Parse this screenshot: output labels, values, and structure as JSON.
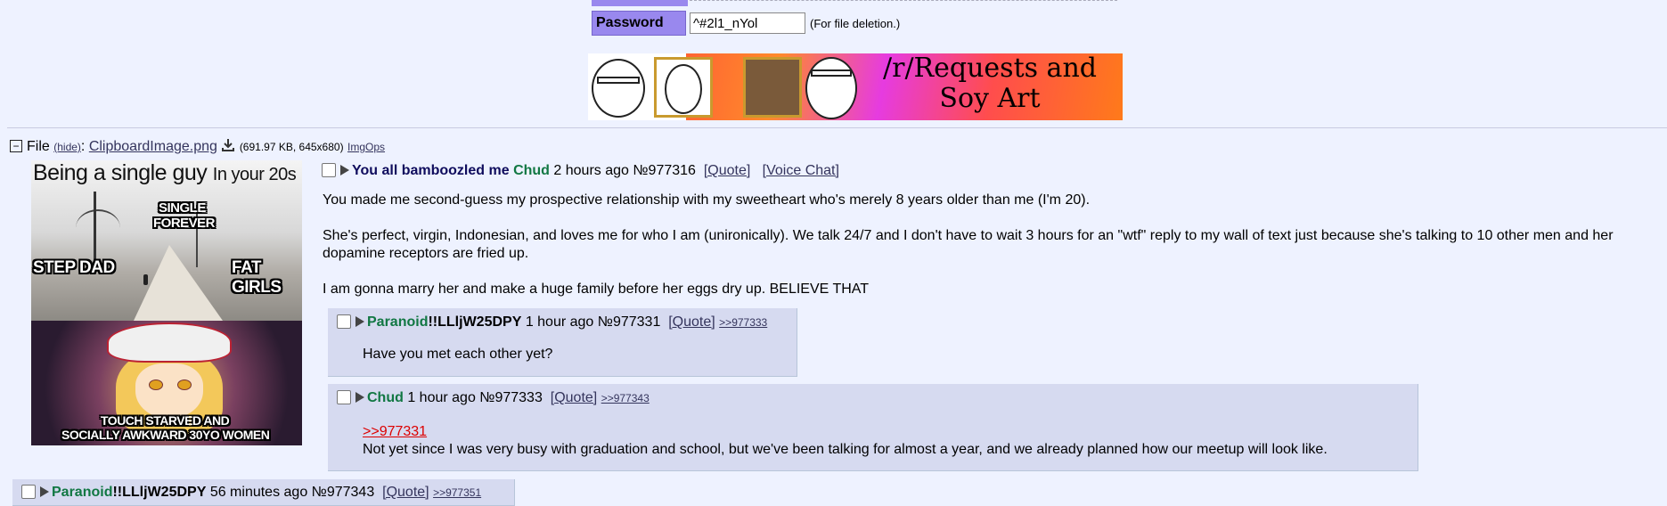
{
  "form": {
    "password_label": "Password",
    "password_value": "^#2l1_nYol",
    "password_note": "(For file deletion.)"
  },
  "banner": {
    "line1": "/r/Requests and",
    "line2": "Soy Art"
  },
  "file": {
    "toggle": "−",
    "label": "File",
    "hide": "(hide)",
    "filename": "ClipboardImage.png",
    "meta": "(691.97 KB, 645x680)",
    "imgops": "ImgOps"
  },
  "thumbnail": {
    "caption_title": "Being a single guy",
    "caption_title_small": "In your 20s",
    "caption_single": "SINGLE",
    "caption_forever": "FOREVER",
    "caption_stepdad": "STEP DAD",
    "caption_fatgirls": "FAT GIRLS",
    "caption_touch1": "TOUCH STARVED AND",
    "caption_touch2": "SOCIALLY AWKWARD 30YO WOMEN"
  },
  "op": {
    "subject": "You all bamboozled me",
    "name": "Chud",
    "time": "2 hours ago",
    "number": "№977316",
    "quote": "[Quote]",
    "voice_chat": "[Voice Chat]",
    "paragraphs": [
      "You made me second-guess my prospective relationship with my sweetheart who's merely 8 years older than me (I'm 20).",
      "She's perfect, virgin, Indonesian, and loves me for who I am (unironically). We talk 24/7 and I don't have to wait 3 hours for an \"wtf\" reply to my wall of text just because she's talking to 10 other men and her dopamine receptors are fried up.",
      "I am gonna marry her and make a huge family before her eggs dry up. BELIEVE THAT"
    ]
  },
  "replies": [
    {
      "name": "Paranoid",
      "trip": "!!LLljW25DPY",
      "time": "1 hour ago",
      "number": "№977331",
      "quote": "[Quote]",
      "backlink": ">>977333",
      "text": "Have you met each other yet?"
    },
    {
      "name": "Chud",
      "time": "1 hour ago",
      "number": "№977333",
      "quote": "[Quote]",
      "backlink": ">>977343",
      "quotelink": ">>977331",
      "text": "Not yet since I was very busy with graduation and school, but we've been talking for almost a year, and we already planned how our meetup will look like."
    },
    {
      "name": "Paranoid",
      "trip": "!!LLljW25DPY",
      "time": "56 minutes ago",
      "number": "№977343",
      "quote": "[Quote]",
      "backlink": ">>977351"
    }
  ]
}
